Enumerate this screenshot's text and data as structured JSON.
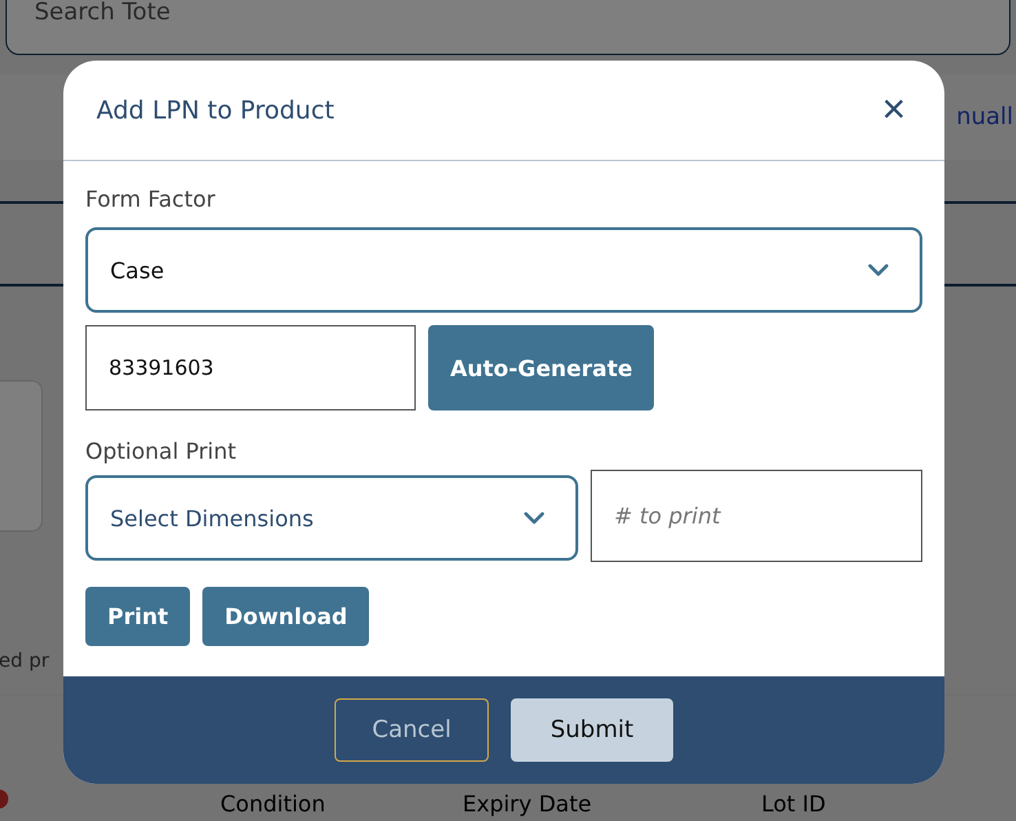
{
  "background": {
    "search_field": {
      "placeholder": "Search Tote"
    },
    "link": "nuall",
    "note": "ed pr",
    "table": {
      "columns": [
        "Condition",
        "Expiry Date",
        "Lot ID"
      ]
    }
  },
  "dialog": {
    "title": "Add LPN to Product",
    "close": "×",
    "form_factor": {
      "label": "Form Factor",
      "value": "Case"
    },
    "lpn": {
      "value": "83391603",
      "button": "Auto-Generate"
    },
    "optional_print": {
      "label": "Optional Print",
      "dimensions": "Select Dimensions",
      "count_placeholder": "# to print"
    },
    "print_buttons": [
      "Print",
      "Download"
    ],
    "footer": {
      "cancel": "Cancel",
      "submit": "Submit"
    }
  }
}
